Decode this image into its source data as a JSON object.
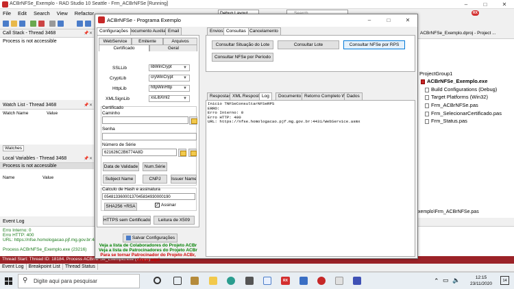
{
  "ide": {
    "title": "ACBrNFSe_Exemplo - RAD Studio 10 Seattle - Frm_ACBrNFSe [Running]",
    "menu": [
      "File",
      "Edit",
      "Search",
      "View",
      "Refactor"
    ],
    "layout_combo": "Debug Layout",
    "search_placeholder": "Search",
    "project_tab": "ACBrNFSe_Exemplo.dproj - Project ...",
    "avatar_badge": "RX"
  },
  "call_stack": {
    "title": "Call Stack - Thread 3468",
    "message": "Process is not accessible"
  },
  "watch_list": {
    "title": "Watch List - Thread 3468",
    "col_name": "Watch Name",
    "col_value": "Value",
    "tab": "Watches"
  },
  "local_vars": {
    "title": "Local Variables - Thread 3468",
    "message": "Process is not accessible",
    "col_name": "Name",
    "col_value": "Value"
  },
  "project_tree": {
    "group": "ProjectGroup1",
    "exe": "ACBrNFSe_Exemplo.exe",
    "items": [
      "Build Configurations (Debug)",
      "Target Platforms (Win32)",
      "Frm_ACBrNFSe.pas",
      "Frm_SelecionarCertificado.pas",
      "Frm_Status.pas"
    ],
    "path": "xemplo\\Frm_ACBrNFSe.pas"
  },
  "event_log": {
    "title": "Event Log",
    "lines": [
      "Erro Interno: 0",
      "Erro HTTP: 400",
      "URL: https://nfse.homologacao.pjf.mg.gov.br:44",
      "",
      "Process ACBrNFSe_Exemplo.exe (23216)"
    ]
  },
  "thread_status": "Thread Start: Thread ID: 18184. Process ACBrNFSe_Exemplo.exe (23216)",
  "bottom_tabs": [
    "Event Log",
    "Breakpoint List",
    "Thread Status"
  ],
  "form": {
    "title": "ACBrNFSe - Programa Exemplo",
    "left_tabs": [
      "Configurações",
      "Documento Auxiliar",
      "Email"
    ],
    "sub_tabs_row1": [
      "WebService",
      "Emitente",
      "Arquivos"
    ],
    "sub_tabs_row2": [
      "Certificado",
      "Geral"
    ],
    "libs": [
      {
        "label": "SSLLib",
        "value": "libWinCrypt"
      },
      {
        "label": "CryptLib",
        "value": "cryWinCrypt"
      },
      {
        "label": "HttpLib",
        "value": "httpWinHttp"
      },
      {
        "label": "XMLSignLib",
        "value": "xsLibXml2"
      }
    ],
    "cert_group": "Certificado",
    "caminho_label": "Caminho",
    "caminho_value": "",
    "senha_label": "Senha",
    "senha_value": "",
    "serie_label": "Número de Série",
    "serie_value": "621626C2B6774A8D",
    "btn_data_validade": "Data de Validade",
    "btn_num_serie": "Num.Série",
    "btn_subject_name": "Subject Name",
    "btn_cnpj": "CNPJ",
    "btn_issuer_name": "Issuer Name",
    "hash_label": "Calculo de Hash e assinatura",
    "hash_value": "05481336000137045834930000190",
    "btn_sha256": "SHA256 +RSA",
    "assinar_label": "Assinar",
    "assinar_checked": true,
    "btn_https": "HTTPS sem Certificado",
    "btn_leitura": "Leitura de X509",
    "btn_salvar": "Salvar Configurações",
    "link_colab": "Veja a lista de Colaboradores do Projeto ACBr",
    "link_patroc": "Veja a lista de Patrocinadores do Projeto ACBr",
    "link_tornar_1": "Para se tornar Patrocinador do Projeto ACBr,",
    "link_tornar_2": "clique aqui",
    "right_tabs": [
      "Envios",
      "Consultas",
      "Cancelamento"
    ],
    "btn_consultar_situacao": "Consultar Situação do Lote",
    "btn_consultar_lote": "Consultar Lote",
    "btn_consultar_rps": "Consultar NFSe por RPS",
    "btn_consultar_periodo": "Consultar NFSe por Período",
    "result_tabs": [
      "Respostas",
      "XML Resposta",
      "Log",
      "Documento",
      "Retorno Completo WS",
      "Dados"
    ],
    "log_lines": [
      "Inicio TNFSeConsultarNFSeRPS",
      "ERRO:",
      "Erro Interno: 0",
      "Erro HTTP: 400",
      "URL: https://nfse.homologacao.pjf.mg.gov.br:4431/WebService.asmx"
    ]
  },
  "taskbar": {
    "search_placeholder": "Digite aqui para pesquisar",
    "time": "12:15",
    "date": "23/11/2020",
    "notif_count": "14"
  }
}
